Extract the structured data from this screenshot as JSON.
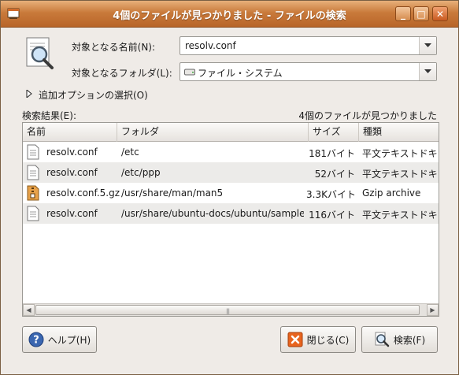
{
  "window": {
    "title": "4個のファイルが見つかりました - ファイルの検索",
    "controls": {
      "minimize": "_",
      "maximize": "□",
      "close": "✕"
    }
  },
  "form": {
    "name_label": "対象となる名前(N):",
    "name_value": "resolv.conf",
    "folder_label": "対象となるフォルダ(L):",
    "folder_value": "ファイル・システム",
    "more_options": "追加オプションの選択(O)"
  },
  "results": {
    "label": "検索結果(E):",
    "count_text": "4個のファイルが見つかりました",
    "columns": {
      "name": "名前",
      "folder": "フォルダ",
      "size": "サイズ",
      "type": "種類"
    },
    "rows": [
      {
        "name": "resolv.conf",
        "folder": "/etc",
        "size": "181バイト",
        "type": "平文テキストドキュメント",
        "icon": "text-file-icon"
      },
      {
        "name": "resolv.conf",
        "folder": "/etc/ppp",
        "size": "52バイト",
        "type": "平文テキストドキュメント",
        "icon": "text-file-icon"
      },
      {
        "name": "resolv.conf.5.gz",
        "folder": "/usr/share/man/man5",
        "size": "3.3Kバイト",
        "type": "Gzip archive",
        "icon": "archive-file-icon"
      },
      {
        "name": "resolv.conf",
        "folder": "/usr/share/ubuntu-docs/ubuntu/sample",
        "size": "116バイト",
        "type": "平文テキストドキュメント",
        "icon": "text-file-icon"
      }
    ]
  },
  "buttons": {
    "help": "ヘルプ(H)",
    "close": "閉じる(C)",
    "search": "検索(F)"
  },
  "colors": {
    "titlebar": "#c97a3b",
    "window_bg": "#efebe7",
    "row_alt": "#ecebe9"
  }
}
